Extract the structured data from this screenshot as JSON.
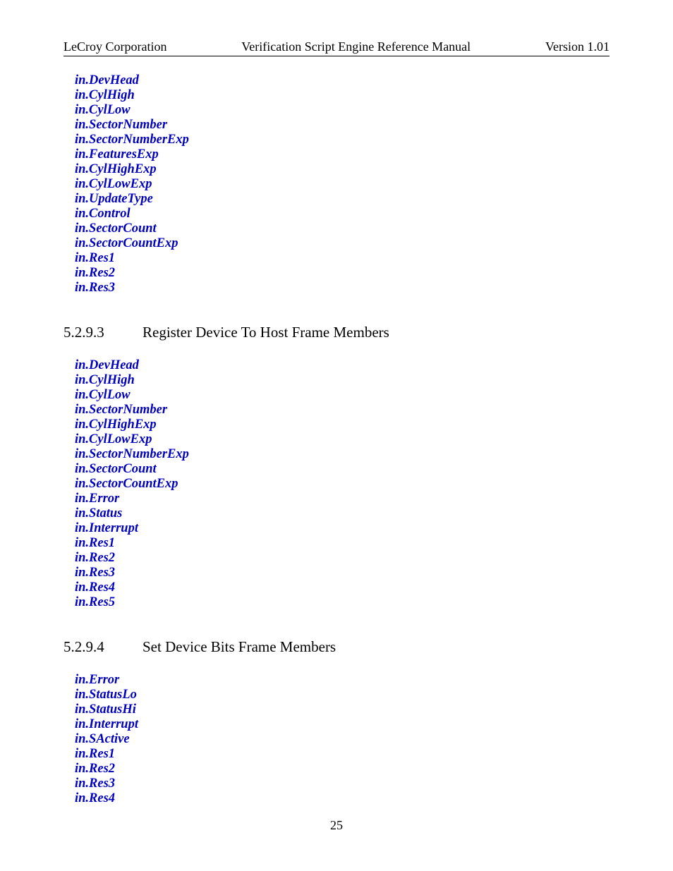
{
  "header": {
    "left": "LeCroy Corporation",
    "center": "Verification Script Engine Reference Manual",
    "right": "Version 1.01"
  },
  "section1_members": [
    "in.DevHead",
    "in.CylHigh",
    "in.CylLow",
    "in.SectorNumber",
    "in.SectorNumberExp",
    "in.FeaturesExp",
    "in.CylHighExp",
    "in.CylLowExp",
    "in.UpdateType",
    "in.Control",
    "in.SectorCount",
    "in.SectorCountExp",
    "in.Res1",
    "in.Res2",
    "in.Res3"
  ],
  "section2": {
    "number": "5.2.9.3",
    "title": "Register Device To Host Frame Members"
  },
  "section2_members": [
    "in.DevHead",
    "in.CylHigh",
    "in.CylLow",
    "in.SectorNumber",
    "in.CylHighExp",
    "in.CylLowExp",
    "in.SectorNumberExp",
    "in.SectorCount",
    "in.SectorCountExp",
    "in.Error",
    "in.Status",
    "in.Interrupt",
    "in.Res1",
    "in.Res2",
    "in.Res3",
    "in.Res4",
    "in.Res5"
  ],
  "section3": {
    "number": "5.2.9.4",
    "title": "Set Device Bits Frame Members"
  },
  "section3_members": [
    "in.Error",
    "in.StatusLo",
    "in.StatusHi",
    "in.Interrupt",
    "in.SActive",
    "in.Res1",
    "in.Res2",
    "in.Res3",
    "in.Res4"
  ],
  "page_number": "25"
}
